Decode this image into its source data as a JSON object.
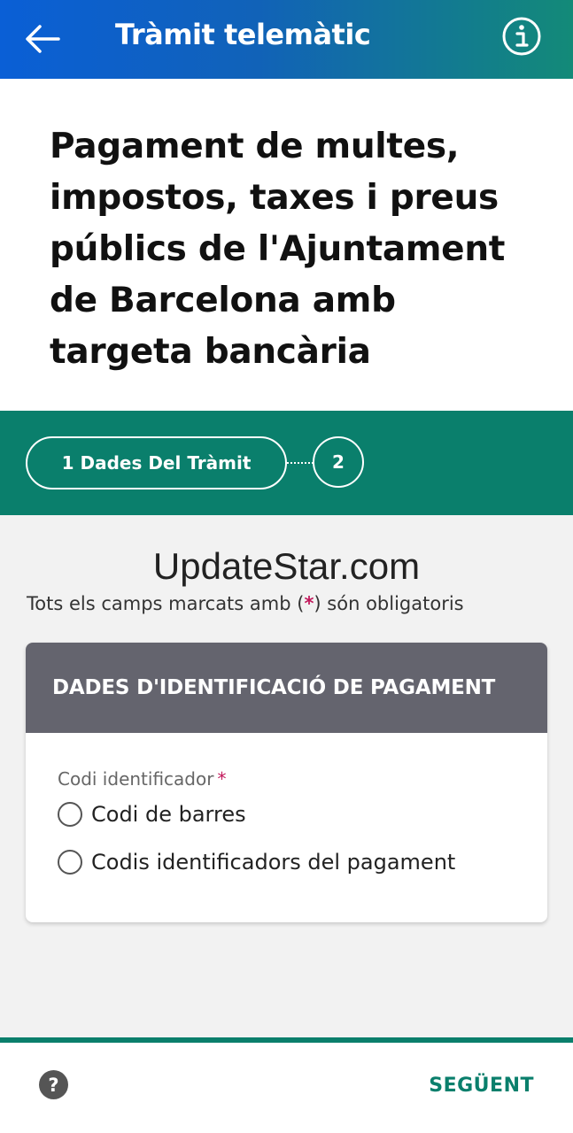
{
  "header": {
    "title": "Tràmit telemàtic",
    "back_icon": "arrow-left-icon",
    "info_icon": "info-icon"
  },
  "page": {
    "title": "Pagament de multes, impostos, taxes i preus públics de l'Ajuntament de Barcelona amb targeta bancària"
  },
  "stepper": {
    "step1_label": "1 Dades Del Tràmit",
    "step2_label": "2"
  },
  "watermark": "UpdateStar.com",
  "required_note": {
    "before": "Tots els camps marcats amb (",
    "star": "*",
    "after": ") són obligatoris"
  },
  "card": {
    "header": "DADES D'IDENTIFICACIÓ DE PAGAMENT",
    "field_label": "Codi identificador",
    "required_star": "*",
    "options": [
      {
        "label": "Codi de barres",
        "selected": false
      },
      {
        "label": "Codis identificadors del pagament",
        "selected": false
      }
    ]
  },
  "footer": {
    "help_label": "?",
    "next_label": "SEGÜENT"
  },
  "colors": {
    "primary_green": "#0a7f6c",
    "header_blue": "#0a5fd6",
    "card_header_gray": "#64646e",
    "required_star": "#c2185b"
  }
}
